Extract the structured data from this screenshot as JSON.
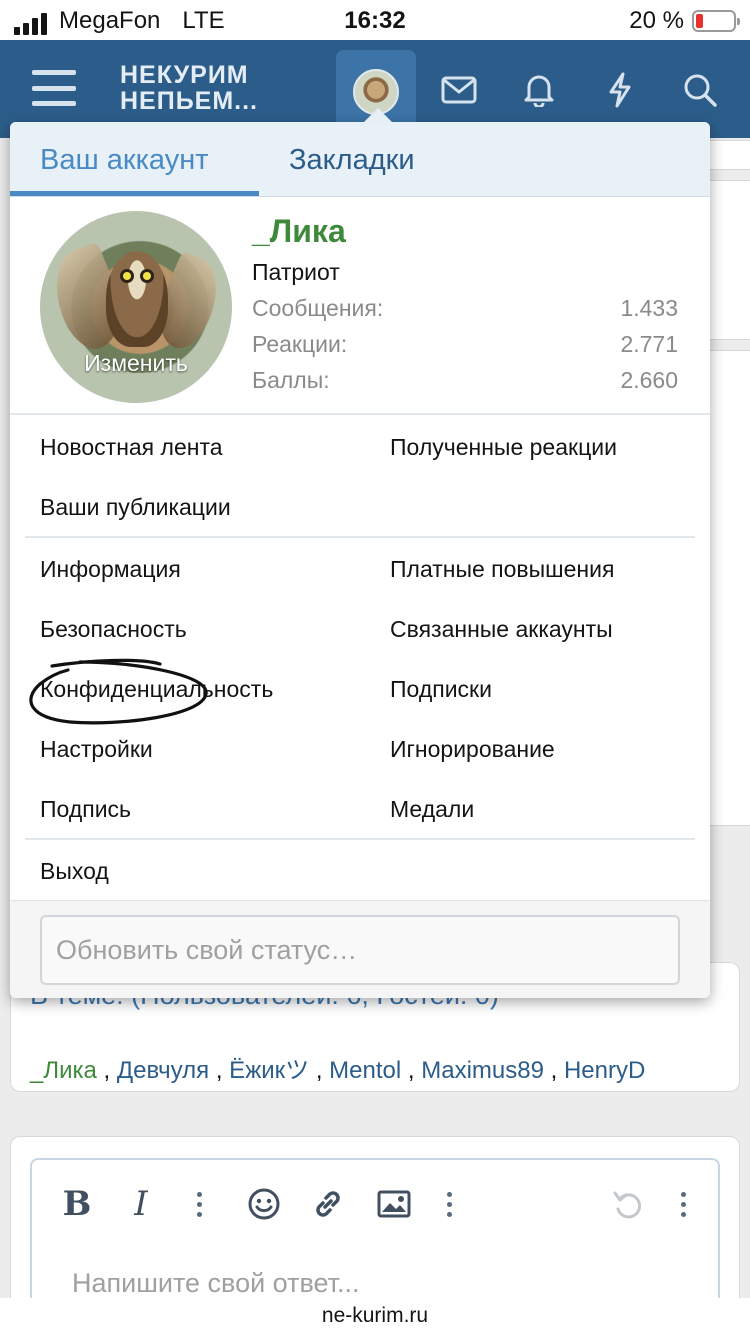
{
  "status_bar": {
    "carrier": "MegaFon",
    "network": "LTE",
    "time": "16:32",
    "battery": "20 %",
    "battery_level": 0.2
  },
  "header": {
    "logo_line1": "НЕКУРИМ",
    "logo_line2": "НЕПЬЕМ..."
  },
  "menu": {
    "tabs": [
      "Ваш аккаунт",
      "Закладки"
    ],
    "profile": {
      "avatar_change": "Изменить",
      "username": "_Лика",
      "user_title": "Патриот",
      "stats": [
        {
          "label": "Сообщения:",
          "value": "1.433"
        },
        {
          "label": "Реакции:",
          "value": "2.771"
        },
        {
          "label": "Баллы:",
          "value": "2.660"
        }
      ]
    },
    "links": {
      "news_feed": "Новостная лента",
      "received_reactions": "Полученные реакции",
      "your_publications": "Ваши публикации",
      "information": "Информация",
      "paid_upgrades": "Платные повышения",
      "security": "Безопасность",
      "connected_accounts": "Связанные аккаунты",
      "privacy": "Конфиденциальность",
      "subscriptions": "Подписки",
      "settings": "Настройки",
      "ignoring": "Игнорирование",
      "signature": "Подпись",
      "medals": "Медали",
      "logout": "Выход"
    },
    "status_placeholder": "Обновить свой статус…"
  },
  "background": {
    "in_topic": "В теме: (Пользователей: 6, Гостей: 0)",
    "users": [
      "_Лика",
      "Девчуля",
      "Ёжикツ",
      "Mentol",
      "Maximus89",
      "HenryD"
    ],
    "reply_placeholder": "Напишите свой ответ..."
  },
  "footer": {
    "domain": "ne-kurim.ru"
  },
  "colors": {
    "header_bg": "#2c5d8a",
    "accent": "#4a8ac4",
    "username": "#3f8a3a",
    "battery_low": "#e8322d"
  }
}
